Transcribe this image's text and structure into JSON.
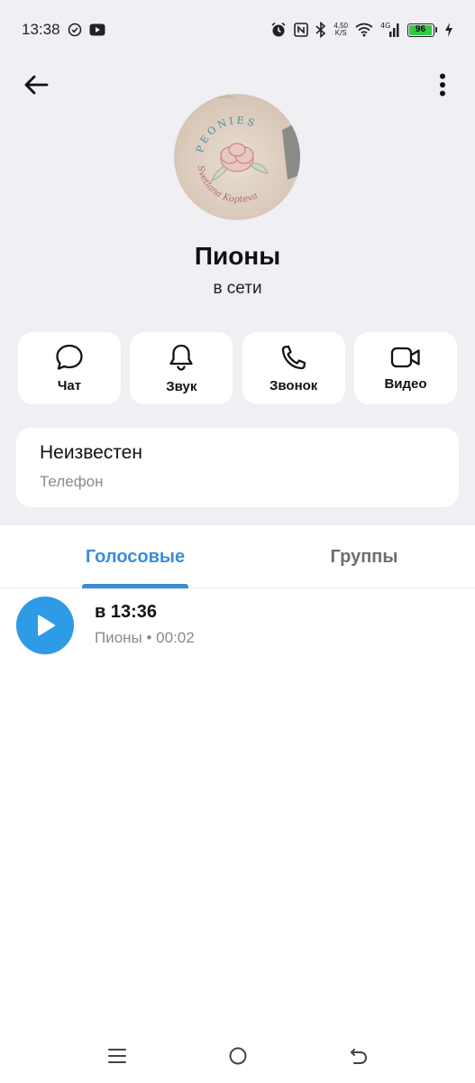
{
  "status_bar": {
    "time": "13:38",
    "net_speed_value": "4,50",
    "net_speed_unit": "K/S",
    "network_type": "4G",
    "battery_level": "96"
  },
  "profile": {
    "name": "Пионы",
    "status": "в сети",
    "avatar_text_top": "PEONIES",
    "avatar_text_bottom": "Svetlana Kopteva"
  },
  "actions": [
    {
      "label": "Чат",
      "icon": "chat-icon"
    },
    {
      "label": "Звук",
      "icon": "bell-icon"
    },
    {
      "label": "Звонок",
      "icon": "phone-icon"
    },
    {
      "label": "Видео",
      "icon": "video-icon"
    }
  ],
  "info": {
    "value": "Неизвестен",
    "label": "Телефон"
  },
  "tabs": [
    {
      "label": "Голосовые",
      "active": true
    },
    {
      "label": "Группы",
      "active": false
    }
  ],
  "voice_messages": [
    {
      "title": "в 13:36",
      "subtitle": "Пионы • 00:02"
    }
  ],
  "colors": {
    "accent": "#3a8dd6",
    "play_button": "#2e9be6",
    "background": "#efeff4",
    "battery": "#2ecc40"
  }
}
